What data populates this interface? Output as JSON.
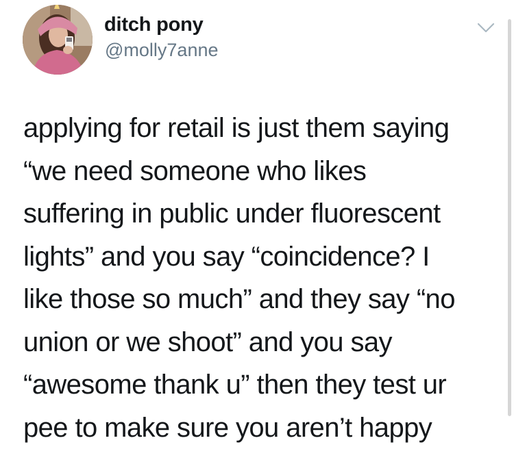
{
  "author": {
    "display_name": "ditch pony",
    "handle": "@molly7anne",
    "avatar_description_icon": "avatar-photo"
  },
  "menu": {
    "icon": "chevron-down-icon",
    "color": "#aab8c2"
  },
  "tweet": {
    "lines": [
      "applying for retail is just them saying",
      "“we need someone who likes",
      "suffering in public under fluorescent",
      "lights” and you say “coincidence? I",
      "like those so much” and they say “no",
      "union or we shoot” and you say",
      "“awesome thank u” then they test ur",
      "pee to make sure you aren’t happy"
    ]
  },
  "colors": {
    "text": "#14171a",
    "secondary": "#657786"
  }
}
